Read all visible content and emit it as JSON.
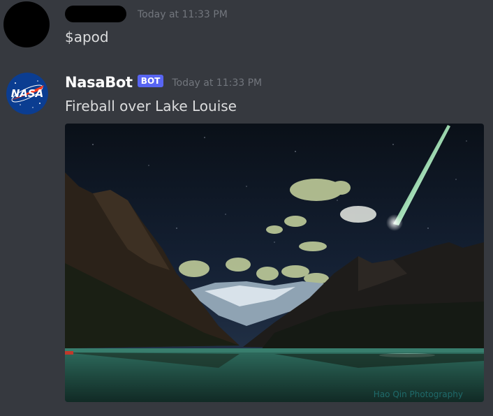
{
  "messages": [
    {
      "username": "",
      "timestamp": "Today at 11:33 PM",
      "content": "$apod"
    },
    {
      "username": "NasaBot",
      "badge": "BOT",
      "timestamp": "Today at 11:33 PM",
      "content": "Fireball over Lake Louise",
      "image_watermark": "Hao Qin Photography",
      "avatar_logo_text": "NASA"
    }
  ],
  "colors": {
    "background": "#36393f",
    "bot_badge": "#5865f2",
    "timestamp": "#72767d",
    "text": "#dcddde"
  }
}
